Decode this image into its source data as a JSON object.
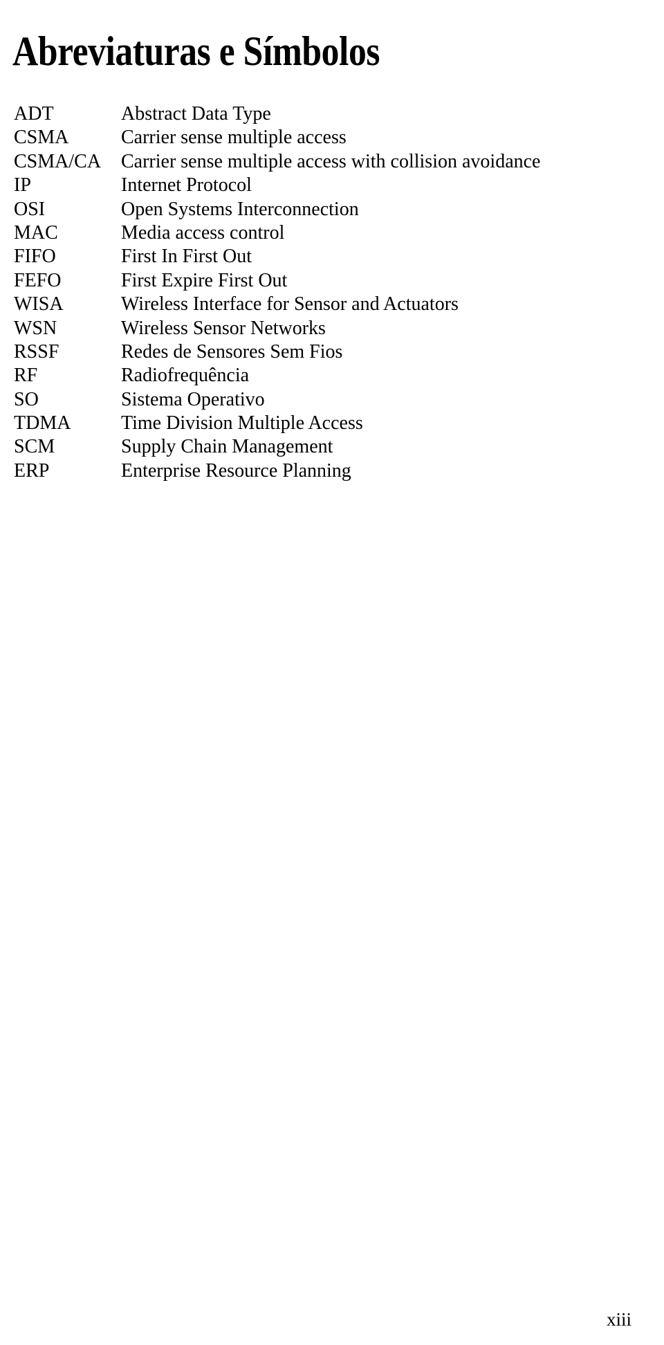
{
  "document": {
    "title": "Abreviaturas e Símbolos",
    "page_number": "xiii",
    "entries": [
      {
        "term": "ADT",
        "definition": "Abstract Data Type"
      },
      {
        "term": "CSMA",
        "definition": "Carrier sense multiple access"
      },
      {
        "term": "CSMA/CA",
        "definition": "Carrier sense multiple access with collision avoidance"
      },
      {
        "term": "IP",
        "definition": "Internet Protocol"
      },
      {
        "term": "OSI",
        "definition": "Open Systems Interconnection"
      },
      {
        "term": "MAC",
        "definition": "Media access control"
      },
      {
        "term": "FIFO",
        "definition": "First In First Out"
      },
      {
        "term": "FEFO",
        "definition": "First Expire First Out"
      },
      {
        "term": "WISA",
        "definition": "Wireless Interface for Sensor and Actuators"
      },
      {
        "term": "WSN",
        "definition": "Wireless Sensor Networks"
      },
      {
        "term": "RSSF",
        "definition": "Redes de Sensores Sem Fios"
      },
      {
        "term": "RF",
        "definition": "Radiofrequência"
      },
      {
        "term": "SO",
        "definition": "Sistema Operativo"
      },
      {
        "term": "TDMA",
        "definition": "Time Division Multiple Access"
      },
      {
        "term": "SCM",
        "definition": "Supply Chain Management"
      },
      {
        "term": "ERP",
        "definition": "Enterprise Resource Planning"
      }
    ]
  }
}
